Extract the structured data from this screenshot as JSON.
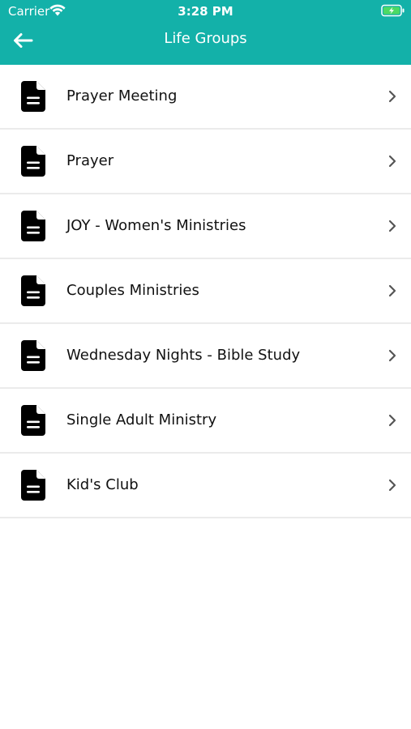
{
  "status_bar": {
    "carrier": "Carrier",
    "time": "3:28 PM",
    "wifi_icon": "wifi-icon",
    "battery_icon": "battery-charging-icon"
  },
  "nav": {
    "title": "Life Groups",
    "back_icon": "arrow-left-icon"
  },
  "colors": {
    "header_background": "#13b1a9",
    "header_text": "#ffffff",
    "row_divider": "#ebebeb",
    "icon": "#000000",
    "chevron": "#555555"
  },
  "list": {
    "item_icon": "document-icon",
    "chevron_icon": "chevron-right-icon",
    "items": [
      {
        "label": "Prayer Meeting"
      },
      {
        "label": "Prayer"
      },
      {
        "label": "JOY - Women's Ministries"
      },
      {
        "label": "Couples Ministries"
      },
      {
        "label": "Wednesday Nights - Bible Study"
      },
      {
        "label": "Single Adult Ministry"
      },
      {
        "label": "Kid's Club"
      }
    ]
  }
}
